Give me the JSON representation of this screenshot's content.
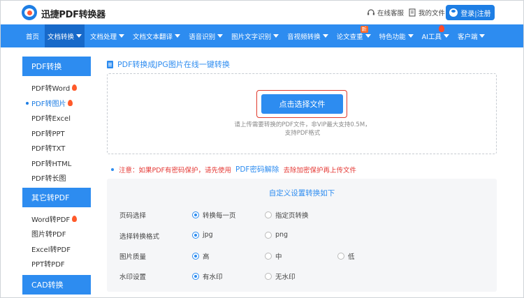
{
  "header": {
    "brand": "迅捷PDF转换器",
    "service_label": "在线客服",
    "my_files_label": "我的文件",
    "login_label": "登录|注册"
  },
  "nav": {
    "items": [
      {
        "label": "首页"
      },
      {
        "label": "文档转换"
      },
      {
        "label": "文档处理"
      },
      {
        "label": "文档文本翻译"
      },
      {
        "label": "语音识别"
      },
      {
        "label": "图片文字识别"
      },
      {
        "label": "音视频转换"
      },
      {
        "label": "论文查重"
      },
      {
        "label": "特色功能"
      },
      {
        "label": "AI工具"
      },
      {
        "label": "客户端"
      }
    ],
    "new_badge": "新"
  },
  "sidebar": {
    "sections": [
      {
        "title": "PDF转换",
        "items": [
          "PDF转Word",
          "PDF转图片",
          "PDF转Excel",
          "PDF转PPT",
          "PDF转TXT",
          "PDF转HTML",
          "PDF转长图"
        ]
      },
      {
        "title": "其它转PDF",
        "items": [
          "Word转PDF",
          "图片转PDF",
          "Excel转PDF",
          "PPT转PDF"
        ]
      },
      {
        "title": "CAD转换",
        "items": []
      }
    ]
  },
  "main": {
    "title": "PDF转换成JPG图片在线一键转换",
    "upload_button": "点击选择文件",
    "upload_hint_1": "请上传需要转换的PDF文件，非VIP最大支持0.5M，",
    "upload_hint_2": "支持PDF格式",
    "notice_prefix": "注意：如果PDF有密码保护，请先使用",
    "notice_link": "PDF密码解除",
    "notice_suffix": "去除加密保护再上传文件"
  },
  "settings": {
    "title": "自定义设置转换如下",
    "rows": [
      {
        "label": "页码选择",
        "options": [
          "转换每一页",
          "指定页转换"
        ]
      },
      {
        "label": "选择转换格式",
        "options": [
          "jpg",
          "png"
        ]
      },
      {
        "label": "图片质量",
        "options": [
          "高",
          "中",
          "低"
        ]
      },
      {
        "label": "水印设置",
        "options": [
          "有水印",
          "无水印"
        ]
      }
    ]
  },
  "colors": {
    "primary": "#2d8cf0",
    "nav_active": "#1769c9",
    "warning": "#e53935",
    "settings_bg": "#f5f6f8"
  }
}
